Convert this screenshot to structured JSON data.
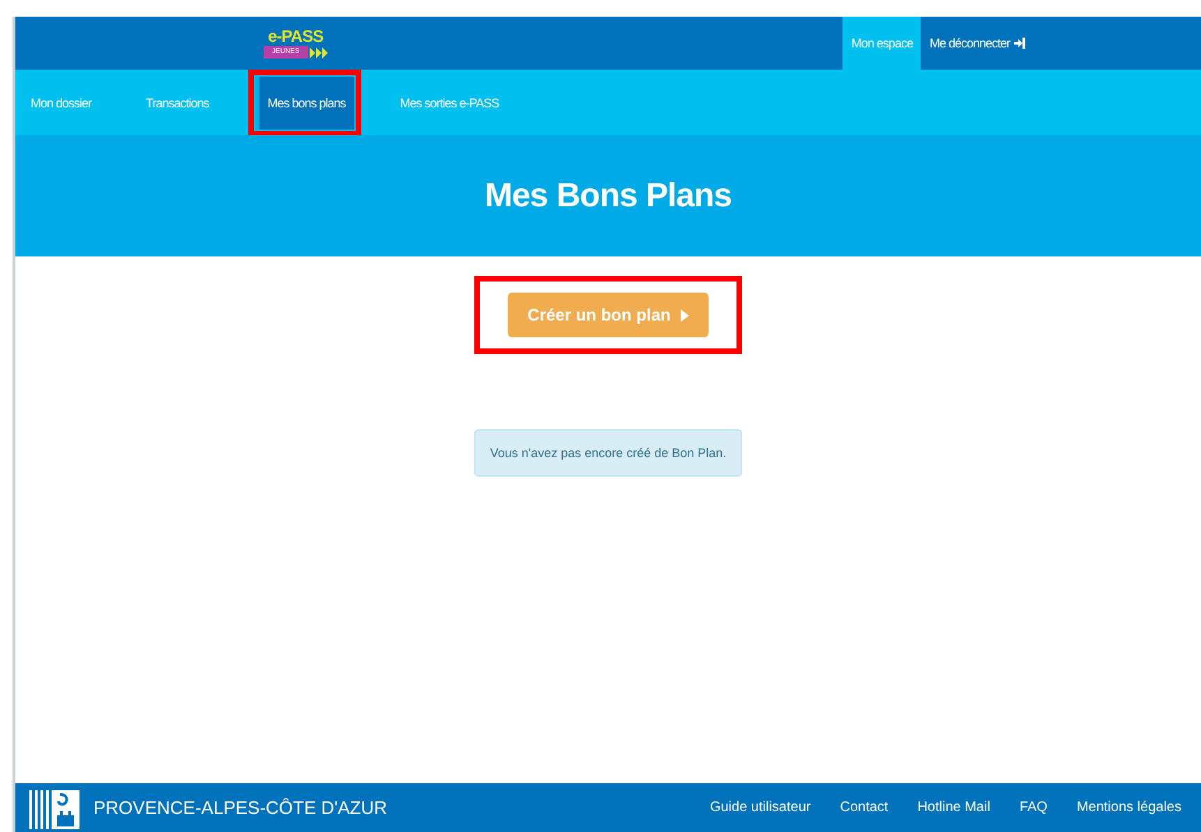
{
  "header": {
    "logo": {
      "title": "e-PASS",
      "badge": "JEUNES"
    },
    "account_links": [
      {
        "label": "Mon espace",
        "selected": true
      },
      {
        "label": "Me déconnecter",
        "selected": false
      }
    ]
  },
  "nav": [
    {
      "label": "Mon dossier",
      "selected": false,
      "highlighted": false
    },
    {
      "label": "Transactions",
      "selected": false,
      "highlighted": false
    },
    {
      "label": "Mes bons plans",
      "selected": true,
      "highlighted": true
    },
    {
      "label": "Mes sorties e-PASS",
      "selected": false,
      "highlighted": false
    }
  ],
  "hero": {
    "title": "Mes Bons Plans"
  },
  "create_button": {
    "label": "Créer un bon plan",
    "highlighted": true
  },
  "notice": "Vous n'avez pas encore créé de Bon Plan.",
  "footer": {
    "region": "PROVENCE-ALPES-CÔTE D'AZUR",
    "links": [
      "Guide utilisateur",
      "Contact",
      "Hotline Mail",
      "FAQ",
      "Mentions légales"
    ]
  }
}
